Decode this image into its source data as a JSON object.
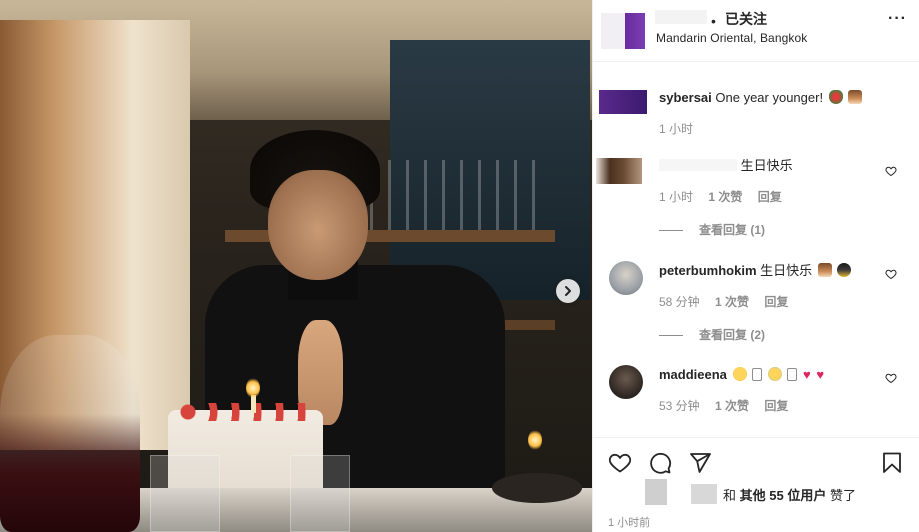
{
  "post": {
    "location": "Mandarin Oriental, Bangkok",
    "follow_label": "已关注",
    "more_label": "···",
    "separator": "•"
  },
  "comments": [
    {
      "username": "sybersai",
      "text": "One year younger!",
      "emojis": [
        "rose",
        "cake"
      ],
      "time": "1 小时",
      "likes_label": "",
      "reply_label": ""
    },
    {
      "username": "",
      "text": "生日快乐",
      "emojis": [],
      "time": "1 小时",
      "likes_label": "1 次赞",
      "reply_label": "回复",
      "view_replies": "查看回复 (1)"
    },
    {
      "username": "peterbumhokim",
      "text": "生日快乐",
      "emojis": [
        "cake",
        "crown"
      ],
      "time": "58 分钟",
      "likes_label": "1 次赞",
      "reply_label": "回复",
      "view_replies": "查看回复 (2)"
    },
    {
      "username": "maddieena",
      "text": "",
      "emojis": [
        "smile",
        "box",
        "cry",
        "box",
        "heart",
        "heart"
      ],
      "time": "53 分钟",
      "likes_label": "1 次赞",
      "reply_label": "回复"
    }
  ],
  "actions": {
    "likes_prefix": "和",
    "likes_others": "其他 55 位用户",
    "likes_suffix": "赞了",
    "time": "1 小时前"
  },
  "icons": {
    "like": "heart-outline-icon",
    "comment": "comment-bubble-icon",
    "share": "paper-plane-icon",
    "save": "bookmark-icon",
    "next": "chevron-right-icon",
    "comment_like": "small-heart-icon"
  },
  "colors": {
    "text": "#262626",
    "muted": "#8e8e8e",
    "border": "#efefef",
    "heart_red": "#e0245e"
  }
}
